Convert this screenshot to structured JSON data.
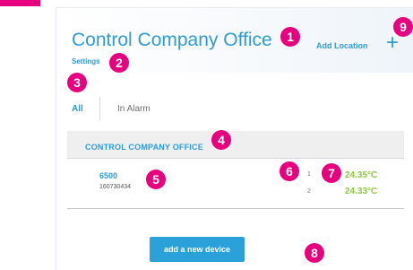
{
  "header": {
    "title": "Control Company Office",
    "settings_label": "Settings",
    "add_location_label": "Add Location",
    "add_location_icon": "plus-icon"
  },
  "tabs": [
    {
      "label": "All",
      "active": true
    },
    {
      "label": "In Alarm",
      "active": false
    }
  ],
  "group": {
    "name": "CONTROL COMPANY OFFICE"
  },
  "device": {
    "name": "6500",
    "serial": "160730434",
    "channels": [
      {
        "number": "1",
        "temperature": "24.35°C"
      },
      {
        "number": "2",
        "temperature": "24.33°C"
      }
    ]
  },
  "add_device_label": "add a new device",
  "callouts": [
    "1",
    "2",
    "3",
    "4",
    "5",
    "6",
    "7",
    "8",
    "9"
  ],
  "colors": {
    "accent": "#2f9bd6",
    "callout": "#e6007e",
    "temperature_ok": "#8dc63f",
    "button": "#2aa1d8"
  }
}
